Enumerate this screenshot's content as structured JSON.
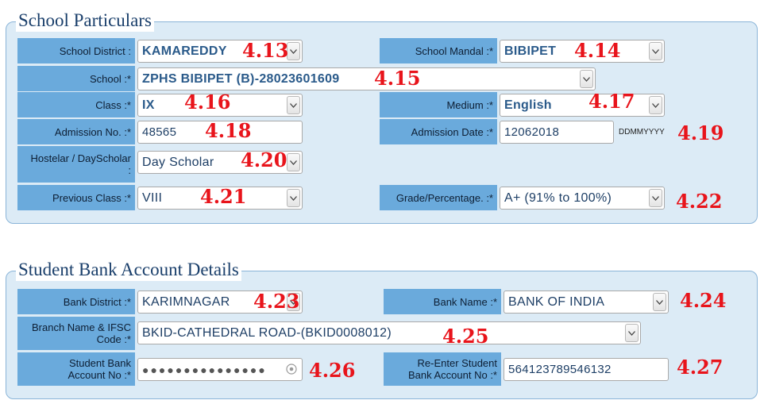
{
  "school": {
    "legend": "School Particulars",
    "district": {
      "label": "School District :",
      "value": "KAMAREDDY",
      "tag": "4.13"
    },
    "mandal": {
      "label": "School Mandal :*",
      "value": "BIBIPET",
      "tag": "4.14"
    },
    "school": {
      "label": "School :*",
      "value": "ZPHS BIBIPET (B)-28023601609",
      "tag": "4.15"
    },
    "class": {
      "label": "Class :*",
      "value": "IX",
      "tag": "4.16"
    },
    "medium": {
      "label": "Medium :*",
      "value": "English",
      "tag": "4.17"
    },
    "admission_no": {
      "label": "Admission No. :*",
      "value": "48565",
      "tag": "4.18"
    },
    "admission_date": {
      "label": "Admission Date :*",
      "value": "12062018",
      "hint": "DDMMYYYY",
      "tag": "4.19"
    },
    "hostelar": {
      "label_line1": "Hostelar / DayScholar",
      "label_line2": ":",
      "value": "Day Scholar",
      "tag": "4.20"
    },
    "previous_class": {
      "label": "Previous Class :*",
      "value": "VIII",
      "tag": "4.21"
    },
    "grade": {
      "label": "Grade/Percentage. :*",
      "value": "A+ (91% to 100%)",
      "tag": "4.22"
    }
  },
  "bank": {
    "legend": "Student Bank Account Details",
    "district": {
      "label": "Bank District :*",
      "value": "KARIMNAGAR",
      "tag": "4.23"
    },
    "name": {
      "label": "Bank Name :*",
      "value": "BANK OF INDIA",
      "tag": "4.24"
    },
    "branch": {
      "label_line1": "Branch Name & IFSC",
      "label_line2": "Code :*",
      "value": "BKID-CATHEDRAL ROAD-(BKID0008012)",
      "tag": "4.25"
    },
    "account": {
      "label_line1": "Student Bank",
      "label_line2": "Account No :*",
      "value": "●●●●●●●●●●●●●●●",
      "tag": "4.26"
    },
    "reenter": {
      "label_line1": "Re-Enter Student",
      "label_line2": "Bank Account No :*",
      "value": "564123789546132",
      "tag": "4.27"
    }
  },
  "icons": {
    "dropdown": "chevron-down-icon",
    "password_reveal": "eye-icon"
  },
  "colors": {
    "label_bg": "#6aaadc",
    "panel_bg": "#dcebf6",
    "tag_red": "#e8141b",
    "legend": "#1a3f6b"
  }
}
